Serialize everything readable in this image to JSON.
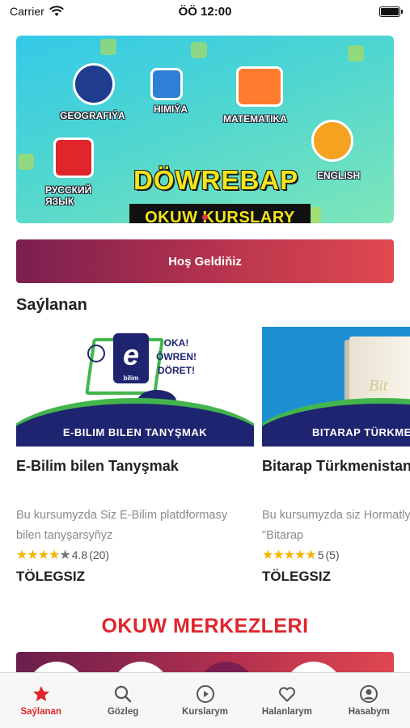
{
  "status_bar": {
    "carrier": "Carrier",
    "time": "ÖÖ 12:00"
  },
  "banner": {
    "title": "DÖWREBAP",
    "subtitle": "OKUW KURSLARY",
    "subjects": [
      "GEOGRAFIÝA",
      "HIMIÝA",
      "MATEMATIKA",
      "РУССКИЙ ЯЗЫК",
      "ENGLISH"
    ],
    "slide_count": 3,
    "active_slide": 1
  },
  "welcome_button": {
    "label": "Hoş Geldiňiz"
  },
  "featured": {
    "section_title": "Saýlanan",
    "courses": [
      {
        "thumb_label": "E-BILIM BILEN TANYŞMAK",
        "thumb_logo": "e",
        "thumb_logo_sub": "bilim",
        "thumb_slogan": "OKA! ÖWREN! DÖRET!",
        "title": "E-Bilim bilen Tanyşmak",
        "description": "Bu kursumyzda Siz E-Bilim platdformasy bilen tanyşarsyňyz",
        "rating": "4.8",
        "rating_count": "(20)",
        "stars_filled": 4,
        "price": "TÖLEGSIZ"
      },
      {
        "thumb_label": "BITARAP TÜRKMENISTAN",
        "thumb_book_text": "Bit",
        "title": "Bitarap Türkmenistan",
        "description": "Bu kursumyzda siz Hormatly Arkadagymyzyň \"Bitarap",
        "rating": "5",
        "rating_count": "(5)",
        "stars_filled": 5,
        "price": "TÖLEGSIZ"
      }
    ]
  },
  "centers": {
    "title": "OKUW MERKEZLERI"
  },
  "tab_bar": {
    "items": [
      {
        "label": "Saýlanan",
        "icon": "star-icon",
        "active": true
      },
      {
        "label": "Gözleg",
        "icon": "search-icon",
        "active": false
      },
      {
        "label": "Kurslarym",
        "icon": "play-circle-icon",
        "active": false
      },
      {
        "label": "Halanlarym",
        "icon": "heart-icon",
        "active": false
      },
      {
        "label": "Hasabym",
        "icon": "user-circle-icon",
        "active": false
      }
    ]
  },
  "colors": {
    "accent": "#e0252b",
    "brand_navy": "#1e2470",
    "brand_green": "#43b54c"
  }
}
